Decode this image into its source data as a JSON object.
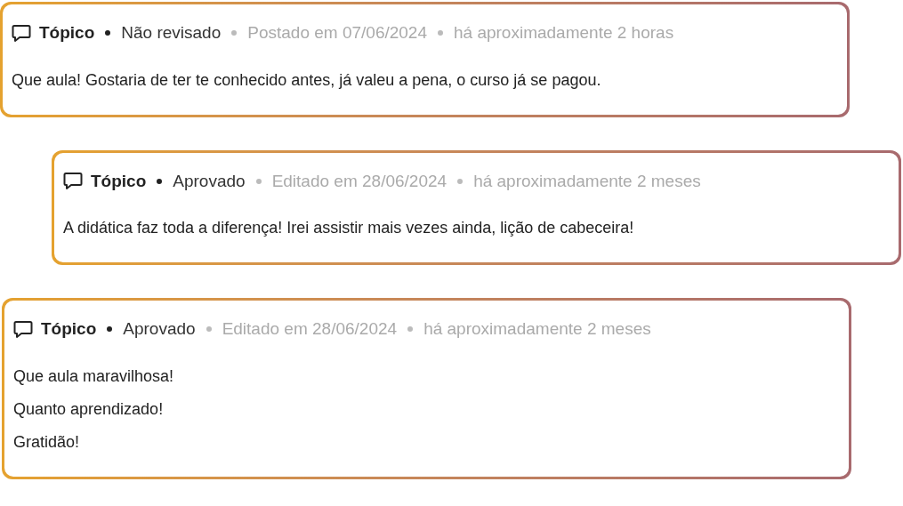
{
  "comments": [
    {
      "type": "Tópico",
      "status": "Não revisado",
      "date": "Postado em 07/06/2024",
      "relative": "há aproximadamente 2 horas",
      "lines": [
        "Que aula! Gostaria de ter te conhecido antes, já valeu a pena, o curso já se pagou."
      ],
      "children": [
        {
          "type": "Tópico",
          "status": "Aprovado",
          "date": "Editado em 28/06/2024",
          "relative": "há aproximadamente 2 meses",
          "lines": [
            "A didática faz toda a diferença! Irei assistir mais vezes ainda, lição de cabeceira!"
          ]
        }
      ]
    },
    {
      "type": "Tópico",
      "status": "Aprovado",
      "date": "Editado em 28/06/2024",
      "relative": "há aproximadamente 2 meses",
      "lines": [
        "Que aula maravilhosa!",
        "Quanto aprendizado!",
        "Gratidão!"
      ]
    }
  ]
}
